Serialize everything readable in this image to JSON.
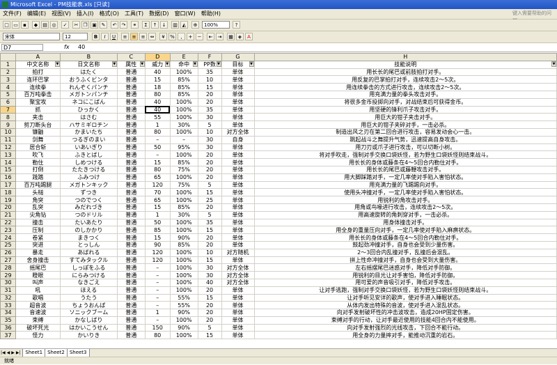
{
  "window": {
    "title": "Microsoft Excel - PM技能表.xls [只读]"
  },
  "menu": {
    "items": [
      "文件(F)",
      "编辑(E)",
      "视图(V)",
      "插入(I)",
      "格式(O)",
      "工具(T)",
      "数据(D)",
      "窗口(W)",
      "帮助(H)"
    ],
    "help_placeholder": "键入需要帮助的问题"
  },
  "toolbar": {
    "zoom": "100%",
    "font_name": "宋体",
    "font_size": "12",
    "bold": "B",
    "italic": "I",
    "underline": "U"
  },
  "formula_bar": {
    "name_box": "D7",
    "fx": "fx",
    "value": "40"
  },
  "columns": [
    "A",
    "B",
    "C",
    "D",
    "E",
    "F",
    "G",
    "H"
  ],
  "headers": [
    "中文名称",
    "日文名称",
    "属性",
    "威力",
    "命中",
    "PP数",
    "目标",
    "技能说明"
  ],
  "rows": [
    [
      "拍打",
      "はたく",
      "普通",
      "40",
      "100%",
      "35",
      "单体",
      "用长长的尾巴或前肢拍打对手。"
    ],
    [
      "连环巴掌",
      "おうふくビンタ",
      "普通",
      "15",
      "85%",
      "10",
      "单体",
      "用反复的巴掌拍打对手，连续攻击2～5次。"
    ],
    [
      "连续拳",
      "れんぞくパンチ",
      "普通",
      "18",
      "85%",
      "15",
      "单体",
      "用连续拳击的方式进行攻击，连续攻击2～5次。"
    ],
    [
      "百万吨拳击",
      "メガトンパンチ",
      "普通",
      "80",
      "85%",
      "20",
      "单体",
      "用充满力量的拳头攻击对手。"
    ],
    [
      "聚宝攻",
      "ネコにこばん",
      "普通",
      "40",
      "100%",
      "20",
      "单体",
      "将很多金币投掷向对手，对战结束后可获得金币。"
    ],
    [
      "抓",
      "ひっかく",
      "普通",
      "40",
      "100%",
      "35",
      "单体",
      "用坚硬的锋利爪子攻击对手。"
    ],
    [
      "夹击",
      "はさむ",
      "普通",
      "55",
      "100%",
      "30",
      "单体",
      "用巨大的钳子夹击对手。"
    ],
    [
      "剪刀断头台",
      "ハサミギロチン",
      "普通",
      "1",
      "30%",
      "5",
      "单体",
      "用巨大的钳子夹碎对手，一击必杀。"
    ],
    [
      "镰鼬",
      "かまいたち",
      "普通",
      "80",
      "100%",
      "10",
      "对方全体",
      "制造出风之刃在第二回合进行攻击，容易发动会心一击。"
    ],
    [
      "剑舞",
      "つるぎのまい",
      "普通",
      "–",
      "–",
      "30",
      "自身",
      "跳起战斗之舞提升气势，迅速提高自身攻击。"
    ],
    [
      "居合斩",
      "いあいぎり",
      "普通",
      "50",
      "95%",
      "30",
      "单体",
      "用刀刃或爪子进行攻击，可以切断小树。"
    ],
    [
      "吹飞",
      "ふきとばし",
      "普通",
      "–",
      "100%",
      "20",
      "单体",
      "将对手吹走，强制对手交换口袋妖怪，若为野生口袋妖怪则结束战斗。"
    ],
    [
      "勒住",
      "しめつける",
      "普通",
      "15",
      "85%",
      "20",
      "单体",
      "用长长的身体或藤条在4～5回合内勒住对手。"
    ],
    [
      "打倒",
      "たたきつける",
      "普通",
      "80",
      "75%",
      "20",
      "单体",
      "用长长的尾巴或藤鞭攻击对手。"
    ],
    [
      "践踏",
      "ふみつけ",
      "普通",
      "65",
      "100%",
      "20",
      "单体",
      "用大脚踩踏对手，一定几率使对手陷入害怕状态。"
    ],
    [
      "百万吨踢腿",
      "メガトンキック",
      "普通",
      "120",
      "75%",
      "5",
      "单体",
      "用充满力量的飞踢踢向对手。"
    ],
    [
      "头槌",
      "ずつき",
      "普通",
      "70",
      "100%",
      "15",
      "单体",
      "使用头冲撞对手，一定几率使对手陷入害怕状态。"
    ],
    [
      "角突",
      "つのでつく",
      "普通",
      "65",
      "100%",
      "25",
      "单体",
      "用锐利的角攻击对手。"
    ],
    [
      "乱突",
      "みだれづき",
      "普通",
      "15",
      "85%",
      "20",
      "单体",
      "用角或鸟喙进行攻击，连续攻击2～5次。"
    ],
    [
      "尖角钻",
      "つのドリル",
      "普通",
      "1",
      "30%",
      "5",
      "单体",
      "用高速旋转的角刺穿对手，一击必杀。"
    ],
    [
      "撞击",
      "たいあたり",
      "普通",
      "50",
      "100%",
      "35",
      "单体",
      "用身体撞击对手。"
    ],
    [
      "压制",
      "のしかかり",
      "普通",
      "85",
      "100%",
      "15",
      "单体",
      "用全身的重量压向对手，一定几率使对手陷入麻痹状态。"
    ],
    [
      "卷紧",
      "まきつく",
      "普通",
      "15",
      "90%",
      "20",
      "单体",
      "用长长的身体或藤条在4～5回合内勒住对手。"
    ],
    [
      "突进",
      "とっしん",
      "普通",
      "90",
      "85%",
      "20",
      "单体",
      "鼓起劲冲撞对手，自身也会受到少量伤害。"
    ],
    [
      "暴走",
      "あばれる",
      "普通",
      "120",
      "100%",
      "10",
      "对方随机",
      "2～3回合内乱撞对手，乱撞后会混乱。"
    ],
    [
      "舍身撞击",
      "すてみタックル",
      "普通",
      "120",
      "100%",
      "15",
      "单体",
      "拼上性命冲撞对手，自身也会受到大量伤害。"
    ],
    [
      "摇尾巴",
      "しっぽをふる",
      "普通",
      "–",
      "100%",
      "30",
      "对方全体",
      "左右摇摆尾巴迷惑对手，降低对手防御。"
    ],
    [
      "瞪眼",
      "にらみつける",
      "普通",
      "–",
      "100%",
      "30",
      "对方全体",
      "用锐利的目光让对手害怕，降低对手防御。"
    ],
    [
      "叫声",
      "なきごえ",
      "普通",
      "–",
      "100%",
      "40",
      "对方全体",
      "用可爱的声音吸引对手，降低对手攻击。"
    ],
    [
      "吼",
      "ほえる",
      "普通",
      "–",
      "100%",
      "20",
      "单体",
      "让对手逃跑，强制对手交换口袋妖怪，若为野生口袋妖怪则结束战斗。"
    ],
    [
      "歌唱",
      "うたう",
      "普通",
      "–",
      "55%",
      "15",
      "单体",
      "让对手听见安详的歌声，使对手进入睡眠状态。"
    ],
    [
      "超音波",
      "ちょうおんぱ",
      "普通",
      "–",
      "55%",
      "20",
      "单体",
      "从体内发出特殊的音波，使对手进入混乱状态。"
    ],
    [
      "音速波",
      "ソニックブーム",
      "普通",
      "1",
      "90%",
      "20",
      "单体",
      "向对手发射破坏性的冲击波攻击，造成20HP固定伤害。"
    ],
    [
      "束缚",
      "かなしばり",
      "普通",
      "–",
      "100%",
      "20",
      "单体",
      "束缚对手的行动，让对手最近使用的技能4回合内不能使用。"
    ],
    [
      "破坏死光",
      "はかいこうせん",
      "普通",
      "150",
      "90%",
      "5",
      "单体",
      "向对手发射强烈的光线攻击，下回合不能行动。"
    ],
    [
      "怪力",
      "かいりき",
      "普通",
      "80",
      "100%",
      "15",
      "单体",
      "用全身的力量摔对手，能推动沉重的岩石。"
    ]
  ],
  "sheets": [
    "Sheet1",
    "Sheet2",
    "Sheet3"
  ],
  "status": "就绪",
  "colors": {
    "title_bar": "#2255c4",
    "chrome": "#ece9d8",
    "active_header": "#f9d68b"
  }
}
